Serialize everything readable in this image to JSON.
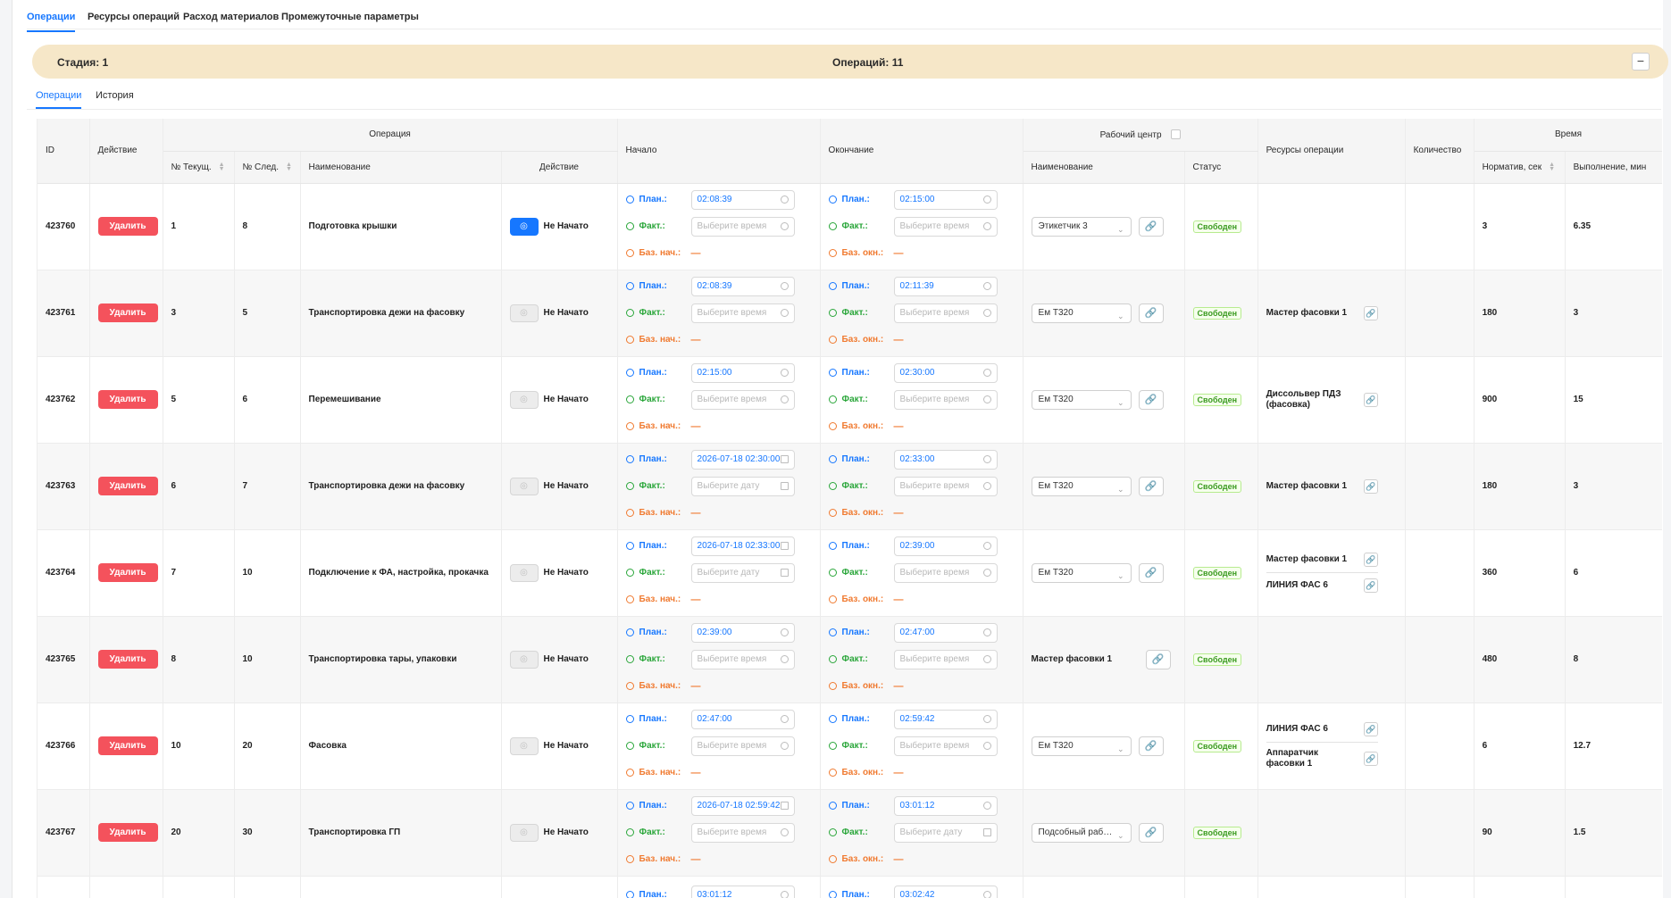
{
  "top_tabs": [
    {
      "label": "Операции",
      "active": true
    },
    {
      "label": "Ресурсы операций",
      "active": false
    },
    {
      "label": "Расход материалов",
      "active": false
    },
    {
      "label": "Промежуточные параметры",
      "active": false
    }
  ],
  "stage": {
    "left": "Стадия: 1",
    "center": "Операций: 11",
    "collapse_icon": "minus-icon"
  },
  "sub_tabs": [
    {
      "label": "Операции",
      "active": true
    },
    {
      "label": "История",
      "active": false
    }
  ],
  "headers": {
    "id": "ID",
    "action": "Действие",
    "operation": "Операция",
    "cur": "№ Текущ.",
    "next": "№ След.",
    "name": "Наименование",
    "op_action": "Действие",
    "start": "Начало",
    "end": "Окончание",
    "work_center": "Рабочий центр",
    "wc_name": "Наименование",
    "wc_status": "Статус",
    "resources": "Ресурсы операции",
    "qty": "Количество",
    "time": "Время",
    "norm": "Норматив, сек",
    "exec": "Выполнение, мин"
  },
  "labels": {
    "delete": "Удалить",
    "not_started": "Не Начато",
    "plan": "План.:",
    "fact": "Факт.:",
    "baz_start": "Баз. нач.:",
    "baz_end": "Баз. окн.:",
    "dash": "—",
    "free": "Свободен"
  },
  "rows": [
    {
      "id": "423760",
      "cur": "1",
      "next": "8",
      "name": "Подготовка крышки",
      "primary": true,
      "start_plan": "02:08:39",
      "start_plan_type": "time",
      "start_fact": "Выберите время",
      "start_fact_type": "time",
      "end_plan": "02:15:00",
      "end_plan_type": "time",
      "end_fact": "Выберите время",
      "end_fact_type": "time",
      "wc": "Этикетчик 3",
      "wc_type": "select",
      "resources": [],
      "norm": "3",
      "exec": "6.35"
    },
    {
      "id": "423761",
      "cur": "3",
      "next": "5",
      "name": "Транспортировка дежи на фасовку",
      "primary": false,
      "start_plan": "02:08:39",
      "start_plan_type": "time",
      "start_fact": "Выберите время",
      "start_fact_type": "time",
      "end_plan": "02:11:39",
      "end_plan_type": "time",
      "end_fact": "Выберите время",
      "end_fact_type": "time",
      "wc": "Ем Т320",
      "wc_type": "select",
      "resources": [
        "Мастер фасовки 1"
      ],
      "norm": "180",
      "exec": "3"
    },
    {
      "id": "423762",
      "cur": "5",
      "next": "6",
      "name": "Перемешивание",
      "primary": false,
      "start_plan": "02:15:00",
      "start_plan_type": "time",
      "start_fact": "Выберите время",
      "start_fact_type": "time",
      "end_plan": "02:30:00",
      "end_plan_type": "time",
      "end_fact": "Выберите время",
      "end_fact_type": "time",
      "wc": "Ем Т320",
      "wc_type": "select",
      "resources": [
        "Диссольвер ПДЗ (фасовка)"
      ],
      "norm": "900",
      "exec": "15"
    },
    {
      "id": "423763",
      "cur": "6",
      "next": "7",
      "name": "Транспортировка дежи на фасовку",
      "primary": false,
      "start_plan": "2026-07-18 02:30:00",
      "start_plan_type": "date",
      "start_fact": "Выберите дату",
      "start_fact_type": "date",
      "end_plan": "02:33:00",
      "end_plan_type": "time",
      "end_fact": "Выберите время",
      "end_fact_type": "time",
      "wc": "Ем Т320",
      "wc_type": "select",
      "resources": [
        "Мастер фасовки 1"
      ],
      "norm": "180",
      "exec": "3"
    },
    {
      "id": "423764",
      "cur": "7",
      "next": "10",
      "name": "Подключение к ФА, настройка, прокачка",
      "primary": false,
      "start_plan": "2026-07-18 02:33:00",
      "start_plan_type": "date",
      "start_fact": "Выберите дату",
      "start_fact_type": "date",
      "end_plan": "02:39:00",
      "end_plan_type": "time",
      "end_fact": "Выберите время",
      "end_fact_type": "time",
      "wc": "Ем Т320",
      "wc_type": "select",
      "resources": [
        "Мастер фасовки 1",
        "ЛИНИЯ ФАС 6"
      ],
      "norm": "360",
      "exec": "6"
    },
    {
      "id": "423765",
      "cur": "8",
      "next": "10",
      "name": "Транспортировка тары, упаковки",
      "primary": false,
      "start_plan": "02:39:00",
      "start_plan_type": "time",
      "start_fact": "Выберите время",
      "start_fact_type": "time",
      "end_plan": "02:47:00",
      "end_plan_type": "time",
      "end_fact": "Выберите время",
      "end_fact_type": "time",
      "wc": "Мастер фасовки 1",
      "wc_type": "text",
      "resources": [],
      "norm": "480",
      "exec": "8"
    },
    {
      "id": "423766",
      "cur": "10",
      "next": "20",
      "name": "Фасовка",
      "primary": false,
      "start_plan": "02:47:00",
      "start_plan_type": "time",
      "start_fact": "Выберите время",
      "start_fact_type": "time",
      "end_plan": "02:59:42",
      "end_plan_type": "time",
      "end_fact": "Выберите время",
      "end_fact_type": "time",
      "wc": "Ем Т320",
      "wc_type": "select",
      "resources": [
        "ЛИНИЯ ФАС 6",
        "Аппаратчик фасовки 1"
      ],
      "norm": "6",
      "exec": "12.7"
    },
    {
      "id": "423767",
      "cur": "20",
      "next": "30",
      "name": "Транспортировка ГП",
      "primary": false,
      "start_plan": "2026-07-18 02:59:42",
      "start_plan_type": "date",
      "start_fact": "Выберите время",
      "start_fact_type": "time",
      "end_plan": "03:01:12",
      "end_plan_type": "time",
      "end_fact": "Выберите дату",
      "end_fact_type": "date",
      "wc": "Подсобный рабо...",
      "wc_type": "select",
      "resources": [],
      "norm": "90",
      "exec": "1.5"
    }
  ],
  "partial_row": {
    "start_plan_label": "План.:",
    "start_plan": "03:01:12",
    "end_plan_label": "План.:",
    "end_plan": "03:02:42"
  },
  "colors": {
    "accent": "#1677ff",
    "danger": "#f4525c",
    "fact": "#2aa63a",
    "baz": "#f07a30",
    "stage_bg": "#f6e7c8",
    "free_badge": "#3a9a1f"
  }
}
